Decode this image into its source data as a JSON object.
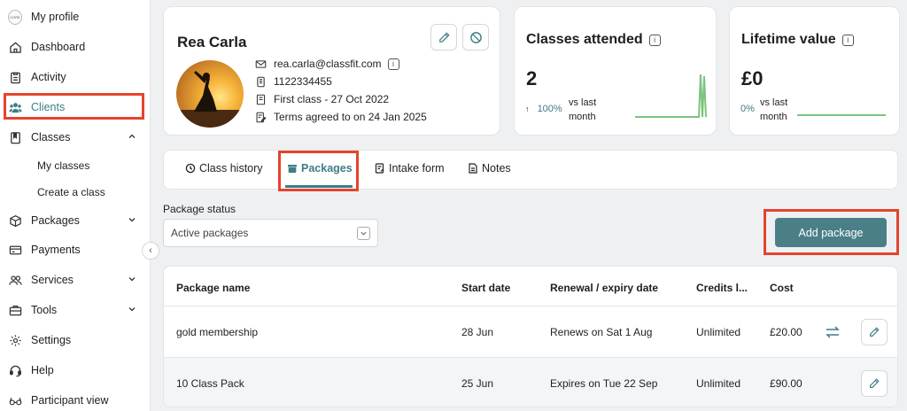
{
  "sidebar": {
    "items": [
      {
        "label": "My profile",
        "icon": "brand-logo-icon"
      },
      {
        "label": "Dashboard",
        "icon": "home-icon"
      },
      {
        "label": "Activity",
        "icon": "clipboard-icon"
      },
      {
        "label": "Clients",
        "icon": "users-icon"
      },
      {
        "label": "Classes",
        "icon": "book-icon"
      },
      {
        "label": "My classes"
      },
      {
        "label": "Create a class"
      },
      {
        "label": "Packages",
        "icon": "box-icon"
      },
      {
        "label": "Payments",
        "icon": "card-icon"
      },
      {
        "label": "Services",
        "icon": "people-icon"
      },
      {
        "label": "Tools",
        "icon": "briefcase-icon"
      },
      {
        "label": "Settings",
        "icon": "gear-icon"
      },
      {
        "label": "Help",
        "icon": "headset-icon"
      },
      {
        "label": "Participant view",
        "icon": "glasses-icon"
      }
    ],
    "logo_text": "CORE",
    "accent": "#3d7d86",
    "highlight_color": "#e5432d"
  },
  "profile": {
    "name": "Rea Carla",
    "email": "rea.carla@classfit.com",
    "phone": "1122334455",
    "first_class": "First class - 27 Oct 2022",
    "terms": "Terms agreed to on 24 Jan 2025"
  },
  "stats": {
    "classes": {
      "title": "Classes attended",
      "value": "2",
      "change": "100%",
      "vs": "vs last",
      "vs2": "month"
    },
    "lifetime": {
      "title": "Lifetime value",
      "value": "£0",
      "change": "0%",
      "vs": "vs last",
      "vs2": "month"
    }
  },
  "tabs": [
    {
      "label": "Class history"
    },
    {
      "label": "Packages"
    },
    {
      "label": "Intake form"
    },
    {
      "label": "Notes"
    }
  ],
  "filters": {
    "status_label": "Package status",
    "status_value": "Active packages"
  },
  "actions": {
    "add_package": "Add package"
  },
  "table": {
    "headers": [
      "Package name",
      "Start date",
      "Renewal / expiry date",
      "Credits l...",
      "Cost"
    ],
    "rows": [
      {
        "name": "gold membership",
        "start": "28 Jun",
        "renewal": "Renews on Sat 1 Aug",
        "credits": "Unlimited",
        "cost": "£20.00"
      },
      {
        "name": "10 Class Pack",
        "start": "25 Jun",
        "renewal": "Expires on Tue 22 Sep",
        "credits": "Unlimited",
        "cost": "£90.00"
      }
    ]
  }
}
